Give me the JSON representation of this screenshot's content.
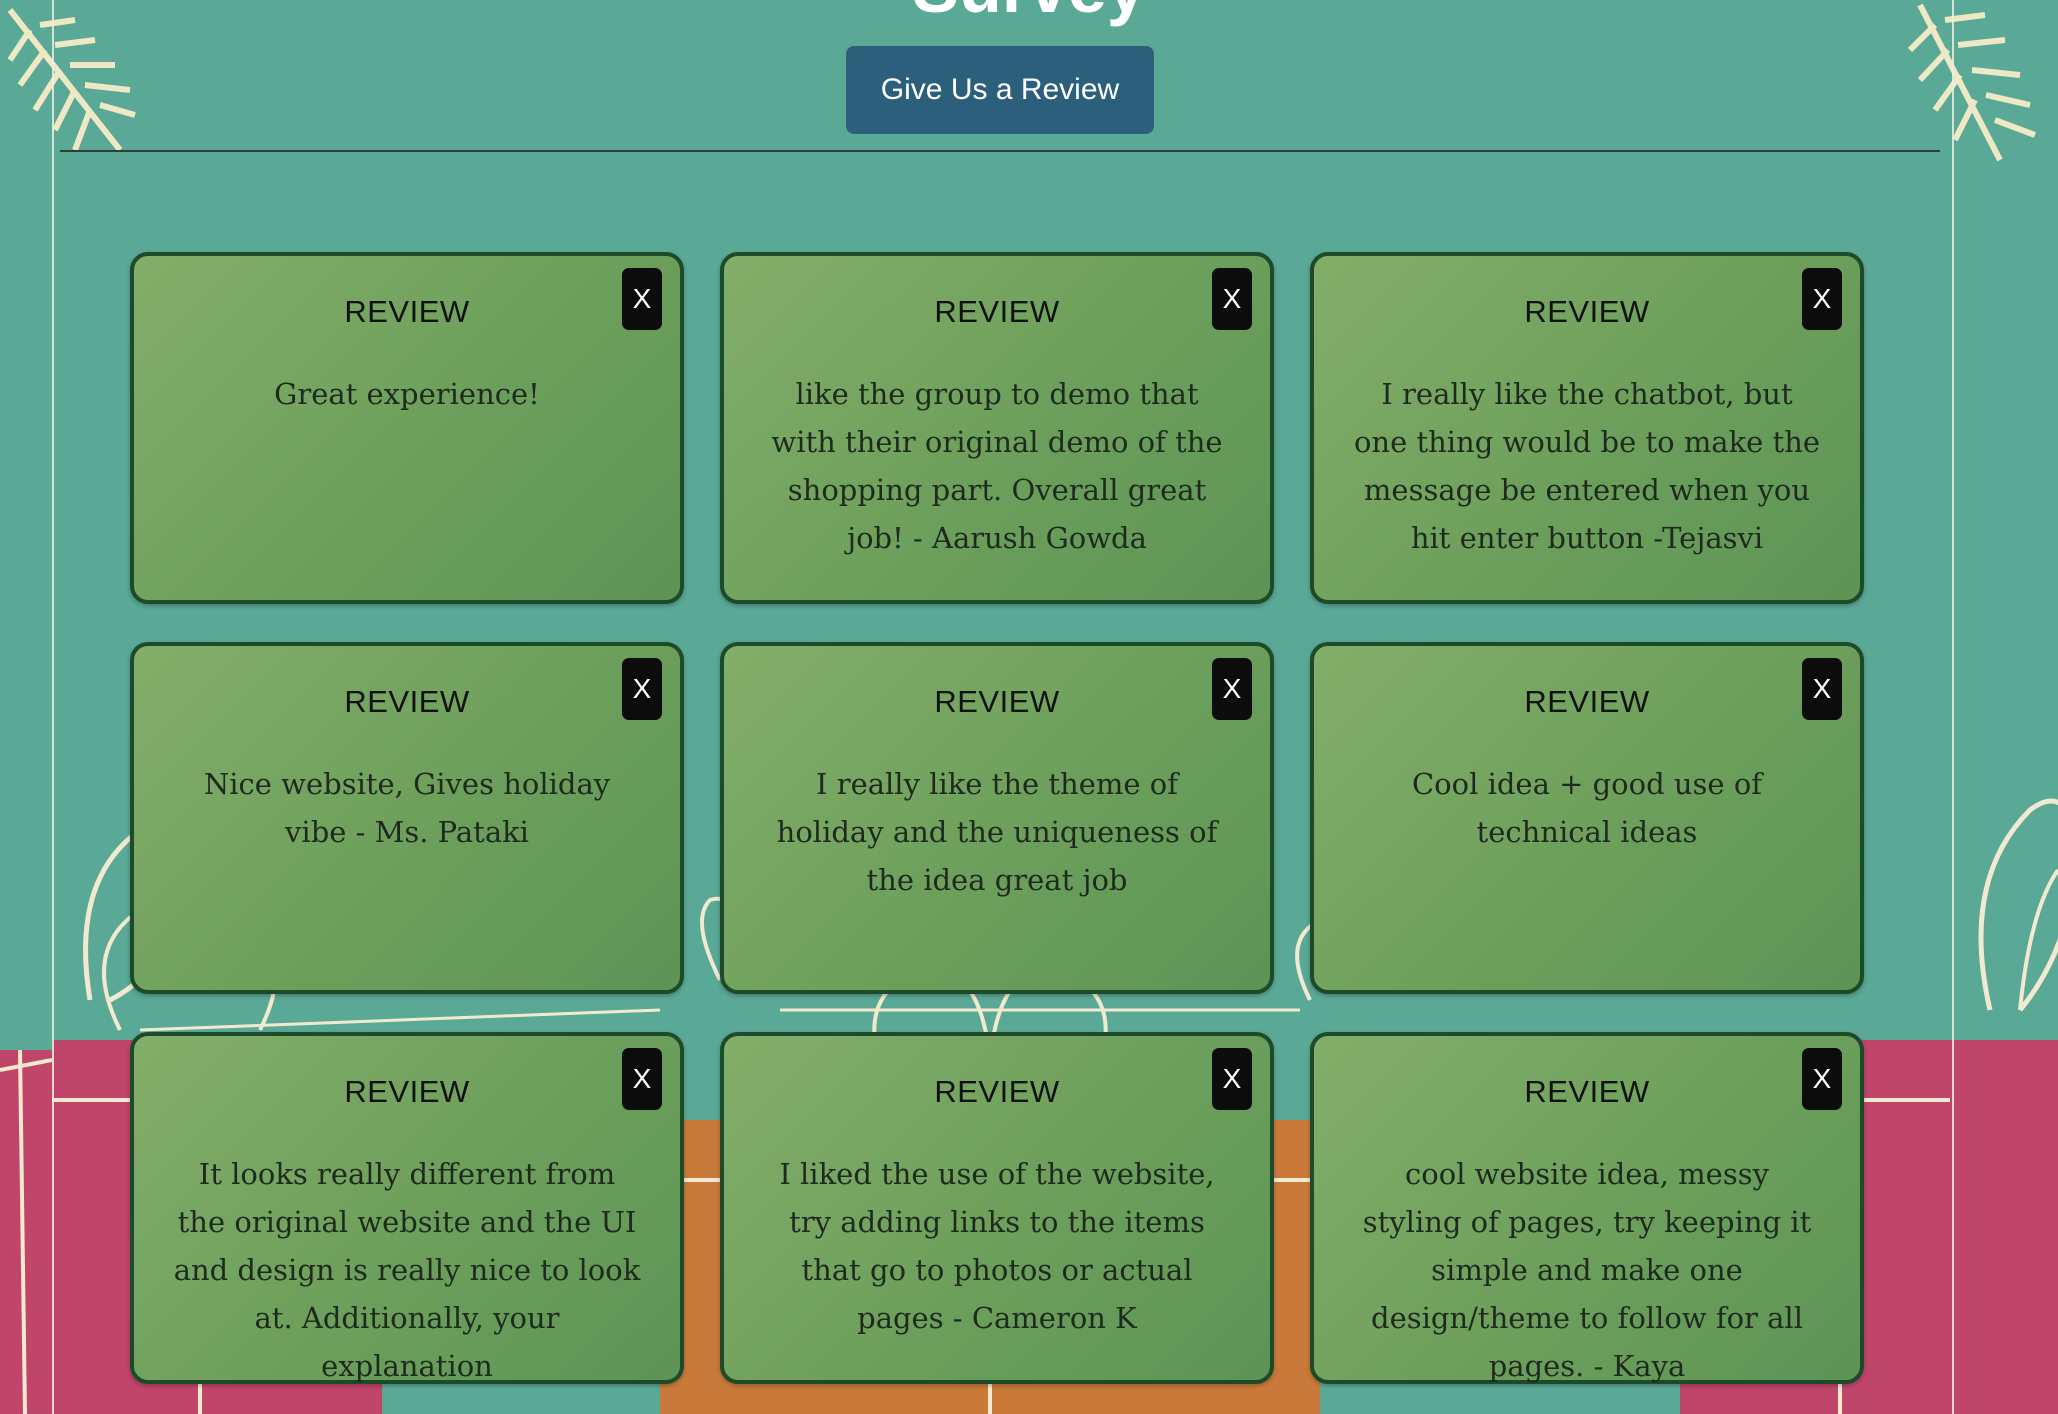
{
  "page": {
    "title": "Survey",
    "review_button_label": "Give Us a Review"
  },
  "colors": {
    "background": "#5aa896",
    "button": "#2c5f7c",
    "card_green": "#74a560",
    "card_border": "#1d4a28",
    "close_button": "#0c0c0c",
    "gift_pink": "#c0456a",
    "gift_orange": "#c97a3a"
  },
  "reviews": [
    {
      "heading": "REVIEW",
      "text": "Great experience!",
      "close_label": "X"
    },
    {
      "heading": "REVIEW",
      "text": "like the group to demo that with their original demo of the shopping part. Overall great job! - Aarush Gowda",
      "close_label": "X"
    },
    {
      "heading": "REVIEW",
      "text": "I really like the chatbot, but one thing would be to make the message be entered when you hit enter button -Tejasvi",
      "close_label": "X"
    },
    {
      "heading": "REVIEW",
      "text": "Nice website, Gives holiday vibe - Ms. Pataki",
      "close_label": "X"
    },
    {
      "heading": "REVIEW",
      "text": "I really like the theme of holiday and the uniqueness of the idea great job",
      "close_label": "X"
    },
    {
      "heading": "REVIEW",
      "text": "Cool idea + good use of technical ideas",
      "close_label": "X"
    },
    {
      "heading": "REVIEW",
      "text": "It looks really different from the original website and the UI and design is really nice to look at. Additionally, your explanation",
      "close_label": "X"
    },
    {
      "heading": "REVIEW",
      "text": "I liked the use of the website, try adding links to the items that go to photos or actual pages - Cameron K",
      "close_label": "X"
    },
    {
      "heading": "REVIEW",
      "text": "cool website idea, messy styling of pages, try keeping it simple and make one design/theme to follow for all pages. - Kaya",
      "close_label": "X"
    }
  ]
}
